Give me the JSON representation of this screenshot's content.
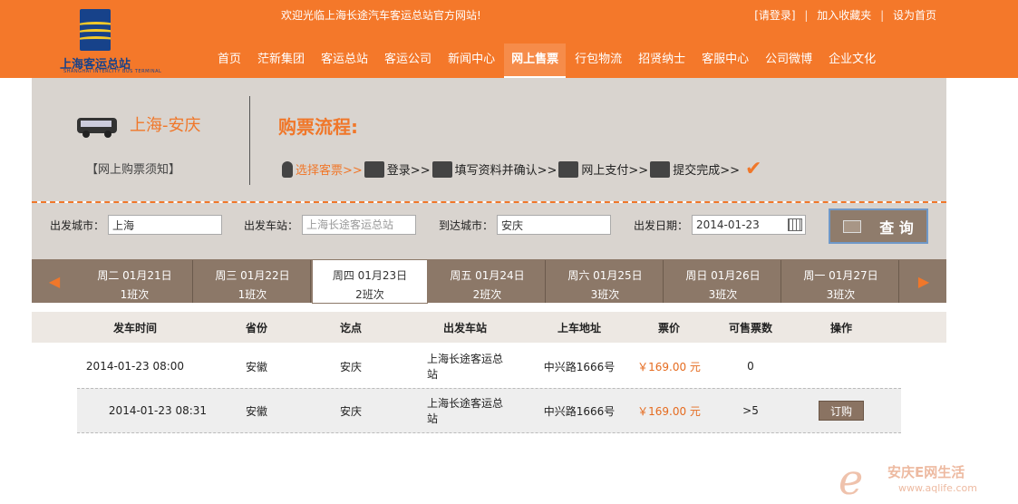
{
  "header": {
    "logo_text": "上海客运总站",
    "logo_sub": "SHANGHAI INTERCITY BUS TERMINAL",
    "welcome": "欢迎光临上海长途汽车客运总站官方网站!",
    "login": "[请登录]",
    "favorite": "加入收藏夹",
    "homepage": "设为首页",
    "nav": [
      "首页",
      "茫新集团",
      "客运总站",
      "客运公司",
      "新闻中心",
      "网上售票",
      "行包物流",
      "招贤纳士",
      "客服中心",
      "公司微博",
      "企业文化"
    ],
    "active_nav": "网上售票"
  },
  "intro": {
    "route": "上海-安庆",
    "notice": "【网上购票须知】",
    "flow_title": "购票流程:",
    "steps": [
      "选择客票>>",
      "登录>>",
      "填写资料并确认>>",
      "网上支付>>",
      "提交完成>>"
    ]
  },
  "search": {
    "from_city_label": "出发城市：",
    "from_city_value": "上海",
    "from_station_label": "出发车站：",
    "from_station_value": "上海长途客运总站",
    "to_city_label": "到达城市：",
    "to_city_value": "安庆",
    "date_label": "出发日期：",
    "date_value": "2014-01-23",
    "query_button": "查 询"
  },
  "date_tabs": [
    {
      "day": "周二 01月21日",
      "count": "1班次"
    },
    {
      "day": "周三 01月22日",
      "count": "1班次"
    },
    {
      "day": "周四 01月23日",
      "count": "2班次"
    },
    {
      "day": "周五 01月24日",
      "count": "2班次"
    },
    {
      "day": "周六 01月25日",
      "count": "3班次"
    },
    {
      "day": "周日 01月26日",
      "count": "3班次"
    },
    {
      "day": "周一 01月27日",
      "count": "3班次"
    }
  ],
  "table": {
    "columns": [
      "发车时间",
      "省份",
      "讫点",
      "出发车站",
      "上车地址",
      "票价",
      "可售票数",
      "操作"
    ],
    "rows": [
      {
        "time": "2014-01-23 08:00",
        "province": "安徽",
        "dest": "安庆",
        "station": "上海长途客运总站",
        "address": "中兴路1666号",
        "price": "￥169.00 元",
        "tickets": "0",
        "action": ""
      },
      {
        "time": "2014-01-23 08:31",
        "province": "安徽",
        "dest": "安庆",
        "station": "上海长途客运总站",
        "address": "中兴路1666号",
        "price": "￥169.00 元",
        "tickets": ">5",
        "action": "订购"
      }
    ]
  },
  "watermark": {
    "title": "安庆E网生活",
    "url": "www.aqlife.com"
  },
  "colors": {
    "orange": "#f4782a",
    "brown": "#8c7868",
    "panel_bg": "#d9d4cf"
  }
}
